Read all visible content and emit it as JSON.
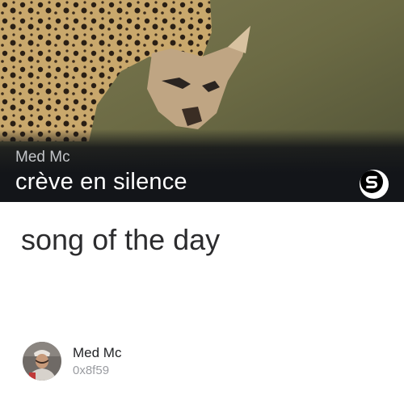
{
  "card": {
    "artist": "Med Mc",
    "track_title": "crève en silence",
    "brand_icon": "s-logo-icon",
    "cover_image": "leopard-carrying-jackal-photo"
  },
  "post": {
    "headline": "song of the day"
  },
  "author": {
    "name": "Med Mc",
    "address": "0x8f59",
    "avatar_icon": "user-avatar"
  },
  "colors": {
    "overlay": "#131519",
    "brand_badge": "#ffffff",
    "text_dark": "#2c2c2e",
    "text_muted": "#9a9ca1"
  }
}
